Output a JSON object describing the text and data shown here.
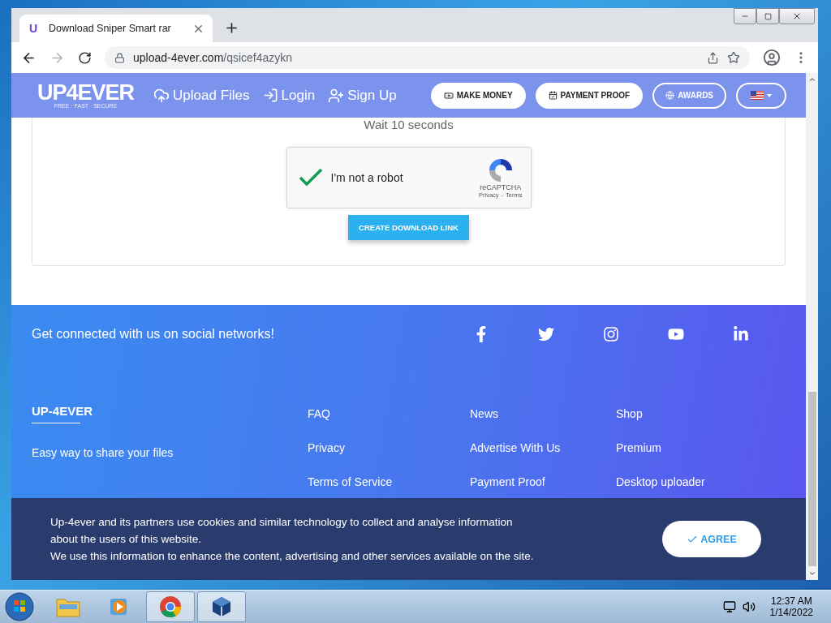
{
  "browser": {
    "tab": {
      "title": "Download Sniper Smart rar",
      "favicon": "U"
    },
    "url": {
      "domain": "upload-4ever.com",
      "path": "/qsicef4azykn"
    }
  },
  "nav": {
    "logo": "UP4EVER",
    "tagline": "FREE · FAST · SECURE",
    "links": [
      {
        "kind": "upload",
        "label": "Upload Files"
      },
      {
        "kind": "login",
        "label": "Login"
      },
      {
        "kind": "signup",
        "label": "Sign Up"
      }
    ],
    "buttons": [
      {
        "kind": "money",
        "label": "MAKE MONEY",
        "filled": true
      },
      {
        "kind": "proof",
        "label": "PAYMENT PROOF",
        "filled": true
      },
      {
        "kind": "awards",
        "label": "AWARDS",
        "filled": false
      }
    ]
  },
  "download": {
    "wait": "Wait 10 seconds",
    "captcha": {
      "label": "I'm not a robot",
      "checked": true,
      "brand": "reCAPTCHA",
      "privacy": "Privacy",
      "separator": "-",
      "terms": "Terms"
    },
    "button": "CREATE DOWNLOAD LINK"
  },
  "footer": {
    "social_text": "Get connected with us on social networks!",
    "social": [
      {
        "kind": "facebook"
      },
      {
        "kind": "twitter"
      },
      {
        "kind": "instagram"
      },
      {
        "kind": "youtube"
      },
      {
        "kind": "linkedin"
      }
    ],
    "brand": "UP-4EVER",
    "slogan": "Easy way to share your files",
    "columns": [
      [
        "FAQ",
        "Privacy",
        "Terms of Service"
      ],
      [
        "News",
        "Advertise With Us",
        "Payment Proof"
      ],
      [
        "Shop",
        "Premium",
        "Desktop uploader"
      ]
    ]
  },
  "cookie": {
    "text": [
      "Up-4ever and its partners use cookies and similar technology to collect and analyse information about the users of this website.",
      "We use this information to enhance the content, advertising and other services available on the site."
    ],
    "button": "AGREE"
  },
  "taskbar": {
    "apps": [
      {
        "kind": "explorer",
        "active": false
      },
      {
        "kind": "media",
        "active": false
      },
      {
        "kind": "chrome",
        "active": true
      },
      {
        "kind": "virtualbox",
        "active": true
      }
    ],
    "time": "12:37 AM",
    "date": "1/14/2022"
  }
}
